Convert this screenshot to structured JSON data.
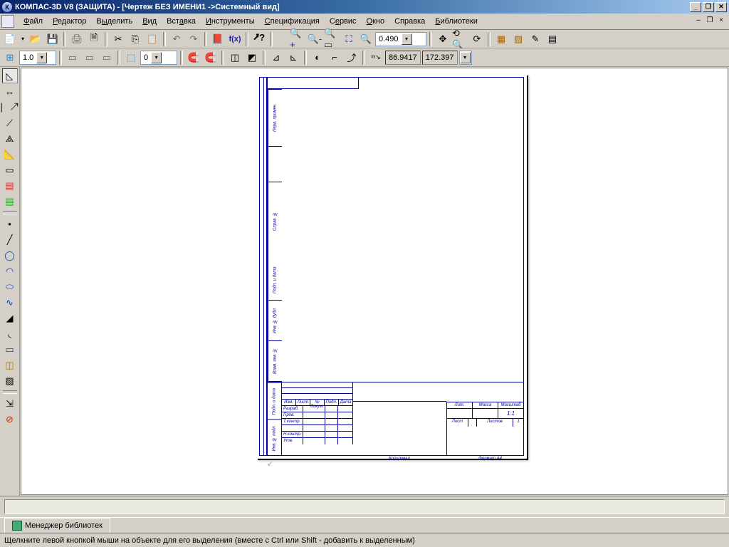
{
  "titlebar": {
    "title": "КОМПАС-3D V8 (ЗАЩИТА) - [Чертеж БЕЗ ИМЕНИ1 ->Системный вид]"
  },
  "menu": {
    "file": "Файл",
    "editor": "Редактор",
    "select": "Выделить",
    "view": "Вид",
    "insert": "Вставка",
    "tools": "Инструменты",
    "spec": "Спецификация",
    "service": "Сервис",
    "window": "Окно",
    "help": "Справка",
    "libs": "Библиотеки"
  },
  "toolbar1": {
    "zoom": "0.490"
  },
  "toolbar2": {
    "weight": "1.0",
    "layer": "0",
    "x": "86.9417",
    "y": "172.397"
  },
  "drawing": {
    "left_cells": [
      "Перв. примен.",
      "",
      "Справ. №"
    ],
    "left2": [
      "Подп. и дата",
      "Инв. № дубл.",
      "Взам. инв. №"
    ],
    "tb_head": [
      "Изм.",
      "Лист",
      "№ докум.",
      "Подп.",
      "Дата"
    ],
    "sig_rows": [
      "Разраб.",
      "Пров.",
      "Т.контр.",
      "",
      "Н.контр.",
      "Утв."
    ],
    "r1": [
      "Лит.",
      "Масса",
      "Масштаб"
    ],
    "scale": "1:1",
    "r3": [
      "Лист",
      "",
      "Листов",
      "1"
    ],
    "lv": [
      "Подп. и дата",
      "Инв. № подл."
    ],
    "footer1": "Копировал",
    "footer2": "Формат   A4"
  },
  "libmgr": {
    "tab": "Менеджер библиотек"
  },
  "status": {
    "hint": "Щелкните левой кнопкой мыши на объекте для его выделения (вместе с Ctrl или Shift - добавить к выделенным)"
  }
}
